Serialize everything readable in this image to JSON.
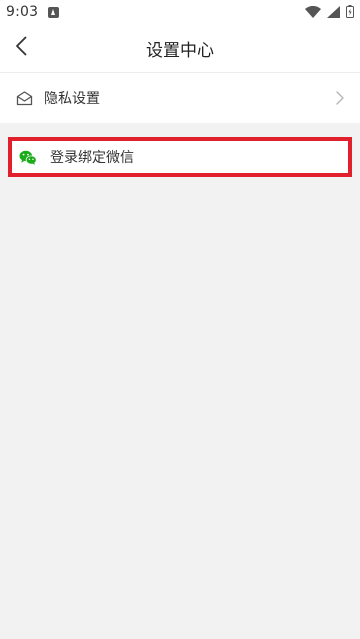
{
  "status_bar": {
    "time": "9:03",
    "icons": [
      "app-notification-icon",
      "wifi-icon",
      "signal-icon",
      "battery-icon"
    ]
  },
  "header": {
    "title": "设置中心",
    "back_icon": "chevron-left-icon"
  },
  "settings": [
    {
      "label": "隐私设置",
      "icon": "mail-open-icon",
      "has_chevron": true
    },
    {
      "label": "登录绑定微信",
      "icon": "wechat-icon",
      "highlighted": true
    }
  ],
  "colors": {
    "highlight_border": "#e0202a",
    "wechat_green": "#1aad19",
    "background": "#f2f2f2"
  }
}
